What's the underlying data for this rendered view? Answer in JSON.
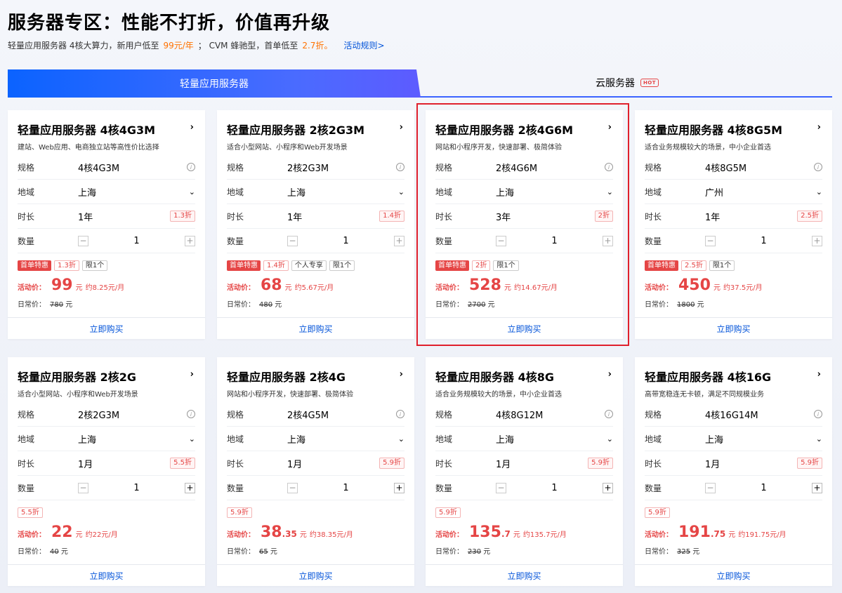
{
  "header": {
    "title": "服务器专区：性能不打折，价值再升级",
    "sub_prefix": "轻量应用服务器 4核大算力，新用户低至",
    "sub_price1": "99元/年",
    "sub_mid": "； CVM 蜂驰型，首单低至",
    "sub_price2": "2.7折。",
    "sub_rules": "活动规则>"
  },
  "tabs": {
    "active": "轻量应用服务器",
    "other": "云服务器",
    "hot": "HOT"
  },
  "labels": {
    "spec": "规格",
    "region": "地域",
    "duration": "时长",
    "qty": "数量",
    "activity_price": "活动价：",
    "regular_price": "日常价：",
    "yuan": "元",
    "buy": "立即购买"
  },
  "colors": {
    "accent": "#0052d9",
    "price": "#e54545",
    "highlight": "#e0202c",
    "tab_gradient_start": "#0b63ff",
    "orange": "#ff7200"
  },
  "cards": [
    {
      "title": "轻量应用服务器 4核4G3M",
      "desc": "建站、Web应用、电商独立站等高性价比选择",
      "spec": "4核4G3M",
      "region": "上海",
      "duration": "1年",
      "discount": "1.3折",
      "qty": "1",
      "tags": [
        "首单特惠",
        "1.3折",
        "限1个"
      ],
      "price_int": "99",
      "price_dec": "",
      "monthly": "约8.25元/月",
      "orig": "780"
    },
    {
      "title": "轻量应用服务器 2核2G3M",
      "desc": "适合小型网站、小程序和Web开发场景",
      "spec": "2核2G3M",
      "region": "上海",
      "duration": "1年",
      "discount": "1.4折",
      "qty": "1",
      "tags": [
        "首单特惠",
        "1.4折",
        "个人专享",
        "限1个"
      ],
      "price_int": "68",
      "price_dec": "",
      "monthly": "约5.67元/月",
      "orig": "480"
    },
    {
      "title": "轻量应用服务器 2核4G6M",
      "desc": "网站和小程序开发，快速部署、极简体验",
      "spec": "2核4G6M",
      "region": "上海",
      "duration": "3年",
      "discount": "2折",
      "qty": "1",
      "tags": [
        "首单特惠",
        "2折",
        "限1个"
      ],
      "price_int": "528",
      "price_dec": "",
      "monthly": "约14.67元/月",
      "orig": "2700"
    },
    {
      "title": "轻量应用服务器 4核8G5M",
      "desc": "适合业务规模较大的场景，中小企业首选",
      "spec": "4核8G5M",
      "region": "广州",
      "duration": "1年",
      "discount": "2.5折",
      "qty": "1",
      "tags": [
        "首单特惠",
        "2.5折",
        "限1个"
      ],
      "price_int": "450",
      "price_dec": "",
      "monthly": "约37.5元/月",
      "orig": "1800"
    },
    {
      "title": "轻量应用服务器 2核2G",
      "desc": "适合小型网站、小程序和Web开发场景",
      "spec": "2核2G3M",
      "region": "上海",
      "duration": "1月",
      "discount": "5.5折",
      "qty": "1",
      "tags": [
        "5.5折"
      ],
      "price_int": "22",
      "price_dec": "",
      "monthly": "约22元/月",
      "orig": "40"
    },
    {
      "title": "轻量应用服务器 2核4G",
      "desc": "网站和小程序开发，快速部署、极简体验",
      "spec": "2核4G5M",
      "region": "上海",
      "duration": "1月",
      "discount": "5.9折",
      "qty": "1",
      "tags": [
        "5.9折"
      ],
      "price_int": "38",
      "price_dec": ".35",
      "monthly": "约38.35元/月",
      "orig": "65"
    },
    {
      "title": "轻量应用服务器 4核8G",
      "desc": "适合业务规模较大的场景，中小企业首选",
      "spec": "4核8G12M",
      "region": "上海",
      "duration": "1月",
      "discount": "5.9折",
      "qty": "1",
      "tags": [
        "5.9折"
      ],
      "price_int": "135",
      "price_dec": ".7",
      "monthly": "约135.7元/月",
      "orig": "230"
    },
    {
      "title": "轻量应用服务器 4核16G",
      "desc": "高带宽稳连无卡顿，满足不同规模业务",
      "spec": "4核16G14M",
      "region": "上海",
      "duration": "1月",
      "discount": "5.9折",
      "qty": "1",
      "tags": [
        "5.9折"
      ],
      "price_int": "191",
      "price_dec": ".75",
      "monthly": "约191.75元/月",
      "orig": "325"
    }
  ]
}
